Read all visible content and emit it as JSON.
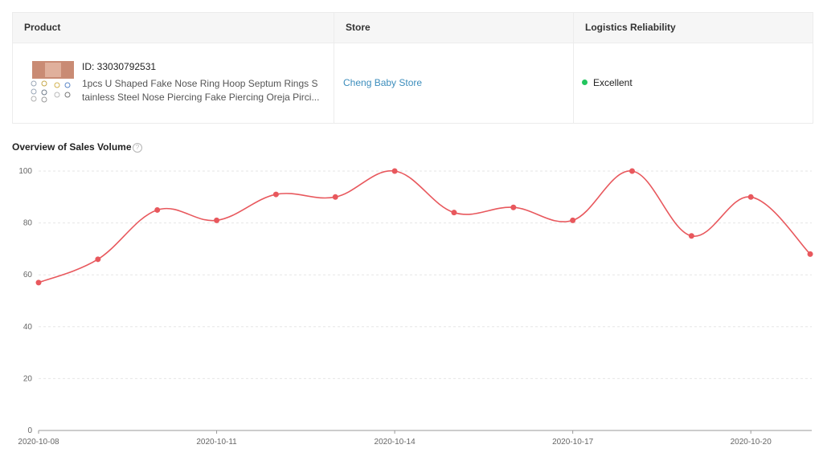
{
  "table": {
    "headers": {
      "product": "Product",
      "store": "Store",
      "logistics": "Logistics Reliability"
    },
    "row": {
      "product_id": "ID: 33030792531",
      "product_title": "1pcs U Shaped Fake Nose Ring Hoop Septum Rings Stainless Steel Nose Piercing Fake Piercing Oreja Pirci...",
      "store_name": "Cheng Baby Store",
      "logistics_status": "Excellent",
      "status_color": "#22c55e"
    }
  },
  "section": {
    "title": "Overview of Sales Volume",
    "help_icon": "question-circle-icon"
  },
  "chart_data": {
    "type": "line",
    "x": [
      "2020-10-08",
      "2020-10-09",
      "2020-10-10",
      "2020-10-11",
      "2020-10-12",
      "2020-10-13",
      "2020-10-14",
      "2020-10-15",
      "2020-10-16",
      "2020-10-17",
      "2020-10-18",
      "2020-10-19",
      "2020-10-20",
      "2020-10-21"
    ],
    "x_tick_labels": [
      "2020-10-08",
      "2020-10-11",
      "2020-10-14",
      "2020-10-17",
      "2020-10-20"
    ],
    "series": [
      {
        "values": [
          57,
          66,
          85,
          81,
          91,
          90,
          100,
          84,
          86,
          81,
          100,
          75,
          90,
          68
        ],
        "color": "#e8585d"
      }
    ],
    "y_ticks": [
      0,
      20,
      40,
      60,
      80,
      100
    ],
    "ylim": [
      0,
      100
    ],
    "grid": true,
    "smooth": true
  }
}
